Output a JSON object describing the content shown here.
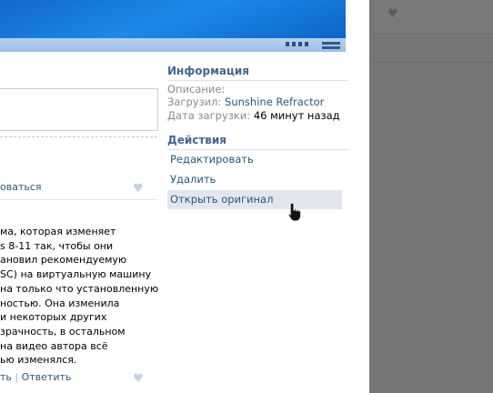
{
  "info": {
    "title": "Информация",
    "description_label": "Описание:",
    "uploader_label": "Загрузил:",
    "uploader_name": "Sunshine Refractor",
    "upload_date_label": "Дата загрузки:",
    "upload_date_value": "46 минут назад"
  },
  "actions": {
    "title": "Действия",
    "items": [
      {
        "label": "Редактировать"
      },
      {
        "label": "Удалить"
      },
      {
        "label": "Открыть оригинал"
      }
    ]
  },
  "comments": {
    "subscribe_fragment": "оваться",
    "text_lines": [
      "ма, которая изменяет",
      "s 8-11 так, чтобы они",
      "ановил рекомендуемую",
      "SC) на виртуальную машину",
      "на только что установленную",
      "ностью. Она изменила",
      "и некоторых других",
      "зрачность, в остальном",
      "на видео автора всё",
      "ью изменялся."
    ],
    "action_fragment": "ть",
    "action_separator": "|",
    "reply_label": "Ответить"
  },
  "icons": {
    "like": "heart-icon",
    "cursor": "hand-pointer-icon"
  },
  "colors": {
    "link": "#2b587a",
    "section_title": "#45688e",
    "overlay": "#767676"
  }
}
